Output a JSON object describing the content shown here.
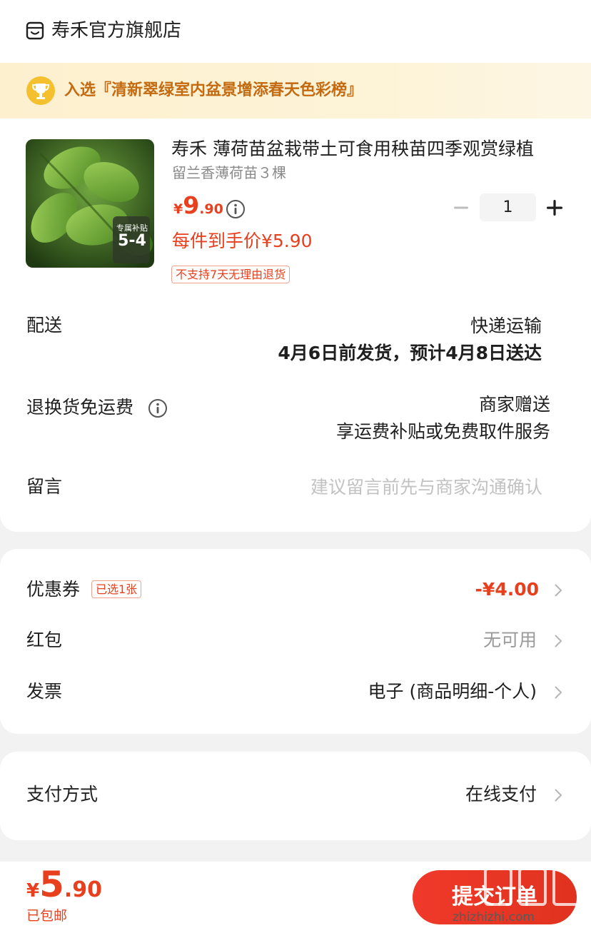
{
  "store": {
    "name": "寿禾官方旗舰店",
    "icon": "store-icon"
  },
  "banner": {
    "text": "入选『清新翠绿室内盆景增添春天色彩榜』",
    "icon": "trophy-icon"
  },
  "product": {
    "title": "寿禾 薄荷苗盆栽带土可食用秧苗四季观赏绿植",
    "spec": "留兰香薄荷苗３棵",
    "price_currency": "¥",
    "price_int": "9",
    "price_dec": ".90",
    "each_price": "每件到手价¥5.90",
    "return_policy": "不支持7天无理由退货",
    "image_badge_title": "专属补贴",
    "image_badge_value": "5-4",
    "quantity": "1"
  },
  "delivery": {
    "label": "配送",
    "method": "快递运输",
    "time": "4月6日前发货，预计4月8日送达"
  },
  "return_shipping": {
    "label": "退换货免运费",
    "value": "商家赠送",
    "sub": "享运费补贴或免费取件服务"
  },
  "message": {
    "label": "留言",
    "placeholder": "建议留言前先与商家沟通确认"
  },
  "coupon": {
    "label": "优惠券",
    "badge": "已选1张",
    "value": "-¥4.00"
  },
  "hongbao": {
    "label": "红包",
    "value": "无可用"
  },
  "invoice": {
    "label": "发票",
    "value": "电子 (商品明细-个人)"
  },
  "payment": {
    "label": "支付方式",
    "value": "在线支付"
  },
  "footer": {
    "total_currency": "¥",
    "total_int": "5",
    "total_dec": ".90",
    "shipping": "已包邮",
    "submit_label": "提交订单",
    "watermark": "zhizhizhi.com"
  },
  "colors": {
    "accent": "#e8401f",
    "banner_text": "#c46a10",
    "banner_bg": "#fdf0cf",
    "trophy": "#f4c02e"
  }
}
